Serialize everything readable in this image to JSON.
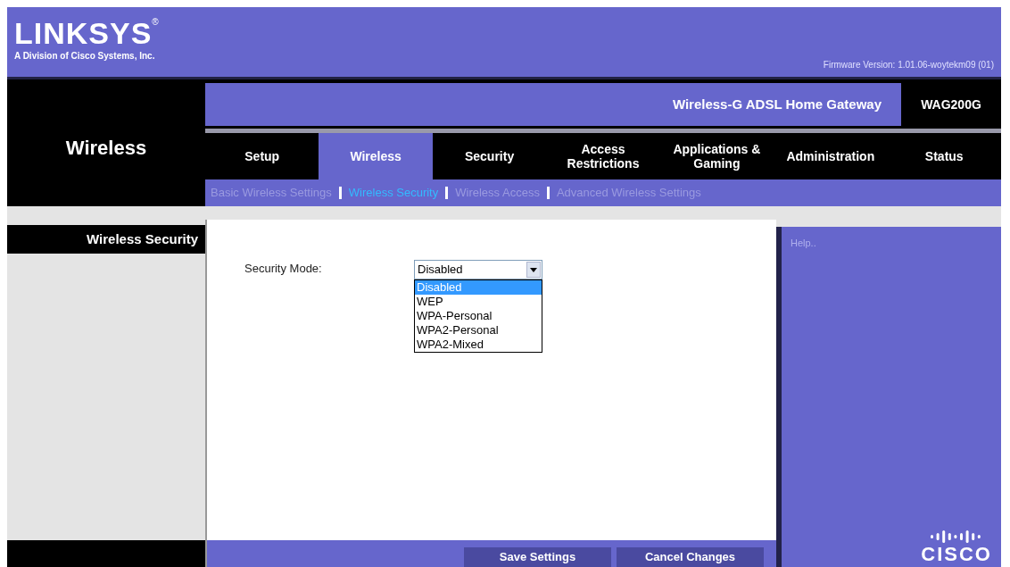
{
  "header": {
    "logo": "LINKSYS",
    "registered": "®",
    "tagline": "A Division of Cisco Systems, Inc.",
    "firmware": "Firmware Version: 1.01.06-woytekm09 (01)"
  },
  "section_title": "Wireless",
  "product": {
    "name": "Wireless-G ADSL Home Gateway",
    "model": "WAG200G"
  },
  "tabs": [
    {
      "label": "Setup",
      "selected": false
    },
    {
      "label": "Wireless",
      "selected": true
    },
    {
      "label": "Security",
      "selected": false
    },
    {
      "label": "Access Restrictions",
      "selected": false
    },
    {
      "label": "Applications & Gaming",
      "selected": false
    },
    {
      "label": "Administration",
      "selected": false
    },
    {
      "label": "Status",
      "selected": false
    }
  ],
  "subtabs": [
    {
      "label": "Basic Wireless Settings",
      "selected": false
    },
    {
      "label": "Wireless Security",
      "selected": true
    },
    {
      "label": "Wireless Access",
      "selected": false
    },
    {
      "label": "Advanced Wireless Settings",
      "selected": false
    }
  ],
  "sidebar": {
    "heading": "Wireless Security"
  },
  "security_mode": {
    "label": "Security Mode:",
    "value": "Disabled",
    "expanded": true,
    "options": [
      {
        "label": "Disabled",
        "selected": true
      },
      {
        "label": "WEP",
        "selected": false
      },
      {
        "label": "WPA-Personal",
        "selected": false
      },
      {
        "label": "WPA2-Personal",
        "selected": false
      },
      {
        "label": "WPA2-Mixed",
        "selected": false
      }
    ]
  },
  "help": {
    "text": "Help..",
    "brand": "CISCO"
  },
  "buttons": [
    "Save Settings",
    "Cancel Changes"
  ]
}
